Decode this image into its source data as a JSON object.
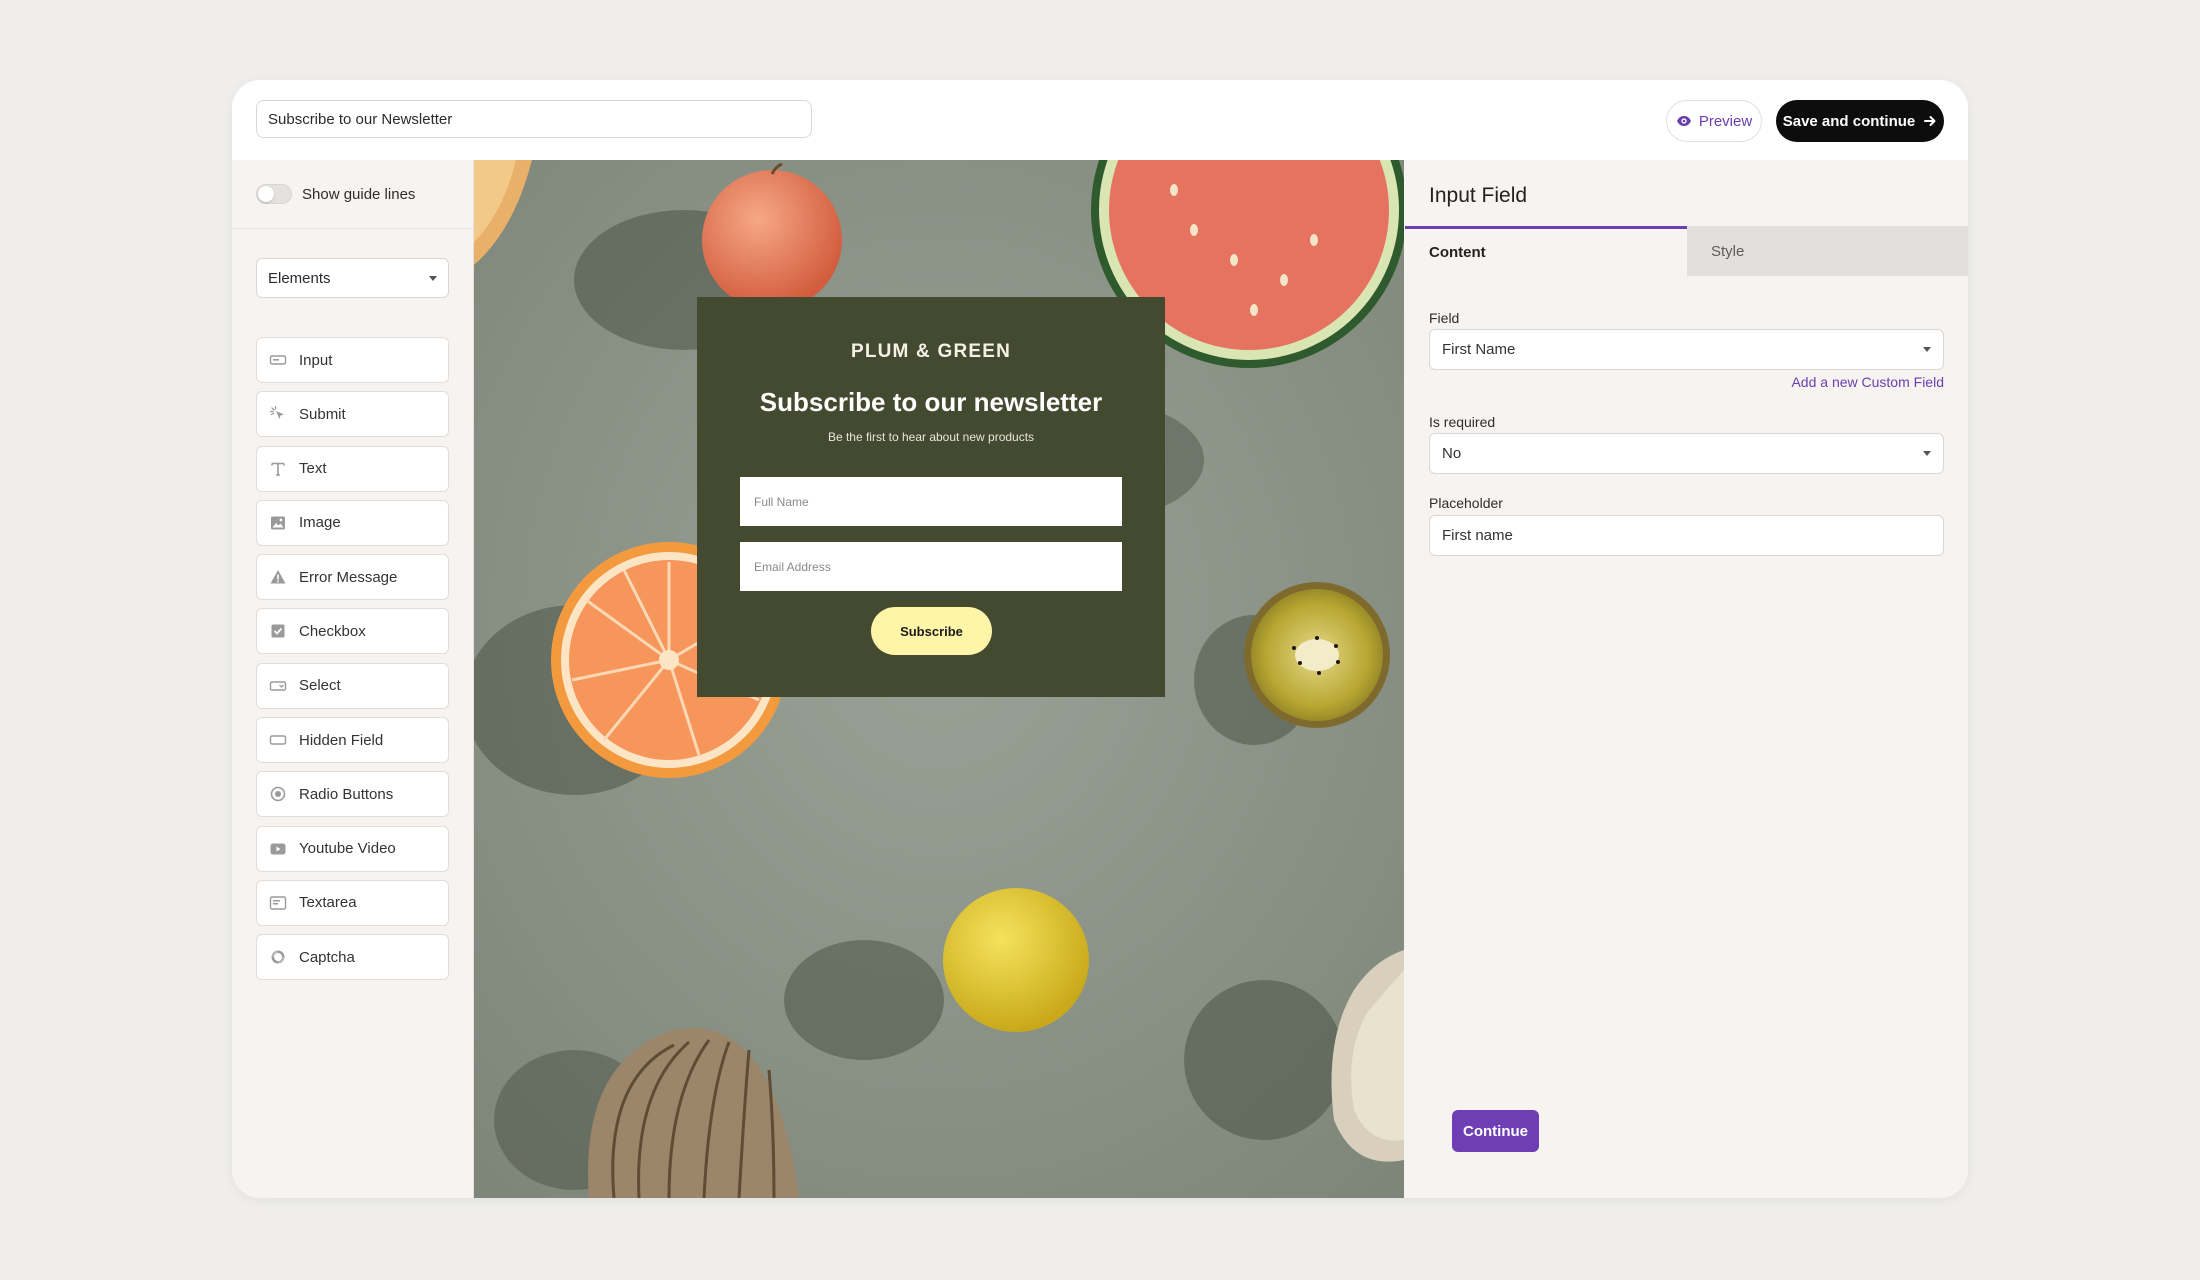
{
  "header": {
    "form_title_value": "Subscribe to our Newsletter",
    "preview_label": "Preview",
    "save_label": "Save and continue"
  },
  "sidebar": {
    "guide_lines_label": "Show guide lines",
    "guide_lines_on": false,
    "elements_dropdown": "Elements",
    "items": [
      {
        "label": "Input",
        "icon": "input-icon"
      },
      {
        "label": "Submit",
        "icon": "cursor-click-icon"
      },
      {
        "label": "Text",
        "icon": "text-icon"
      },
      {
        "label": "Image",
        "icon": "image-icon"
      },
      {
        "label": "Error Message",
        "icon": "warning-icon"
      },
      {
        "label": "Checkbox",
        "icon": "checkbox-icon"
      },
      {
        "label": "Select",
        "icon": "select-icon"
      },
      {
        "label": "Hidden Field",
        "icon": "hidden-field-icon"
      },
      {
        "label": "Radio Buttons",
        "icon": "radio-icon"
      },
      {
        "label": "Youtube Video",
        "icon": "video-icon"
      },
      {
        "label": "Textarea",
        "icon": "textarea-icon"
      },
      {
        "label": "Captcha",
        "icon": "captcha-icon"
      }
    ]
  },
  "canvas": {
    "brand": "PLUM & GREEN",
    "title": "Subscribe to our newsletter",
    "subtitle": "Be the first to hear about new products",
    "full_name_placeholder": "Full Name",
    "email_placeholder": "Email Address",
    "subscribe_label": "Subscribe",
    "card_color": "#434a30",
    "button_color": "#fff5a8"
  },
  "panel": {
    "title": "Input Field",
    "tabs": [
      {
        "label": "Content",
        "active": true
      },
      {
        "label": "Style",
        "active": false
      }
    ],
    "field_label": "Field",
    "field_value": "First Name",
    "custom_field_link": "Add a new Custom Field",
    "required_label": "Is required",
    "required_value": "No",
    "placeholder_label": "Placeholder",
    "placeholder_value": "First name",
    "continue_label": "Continue"
  },
  "colors": {
    "accent": "#6a3fb0",
    "dark_button": "#0d0d0d"
  }
}
